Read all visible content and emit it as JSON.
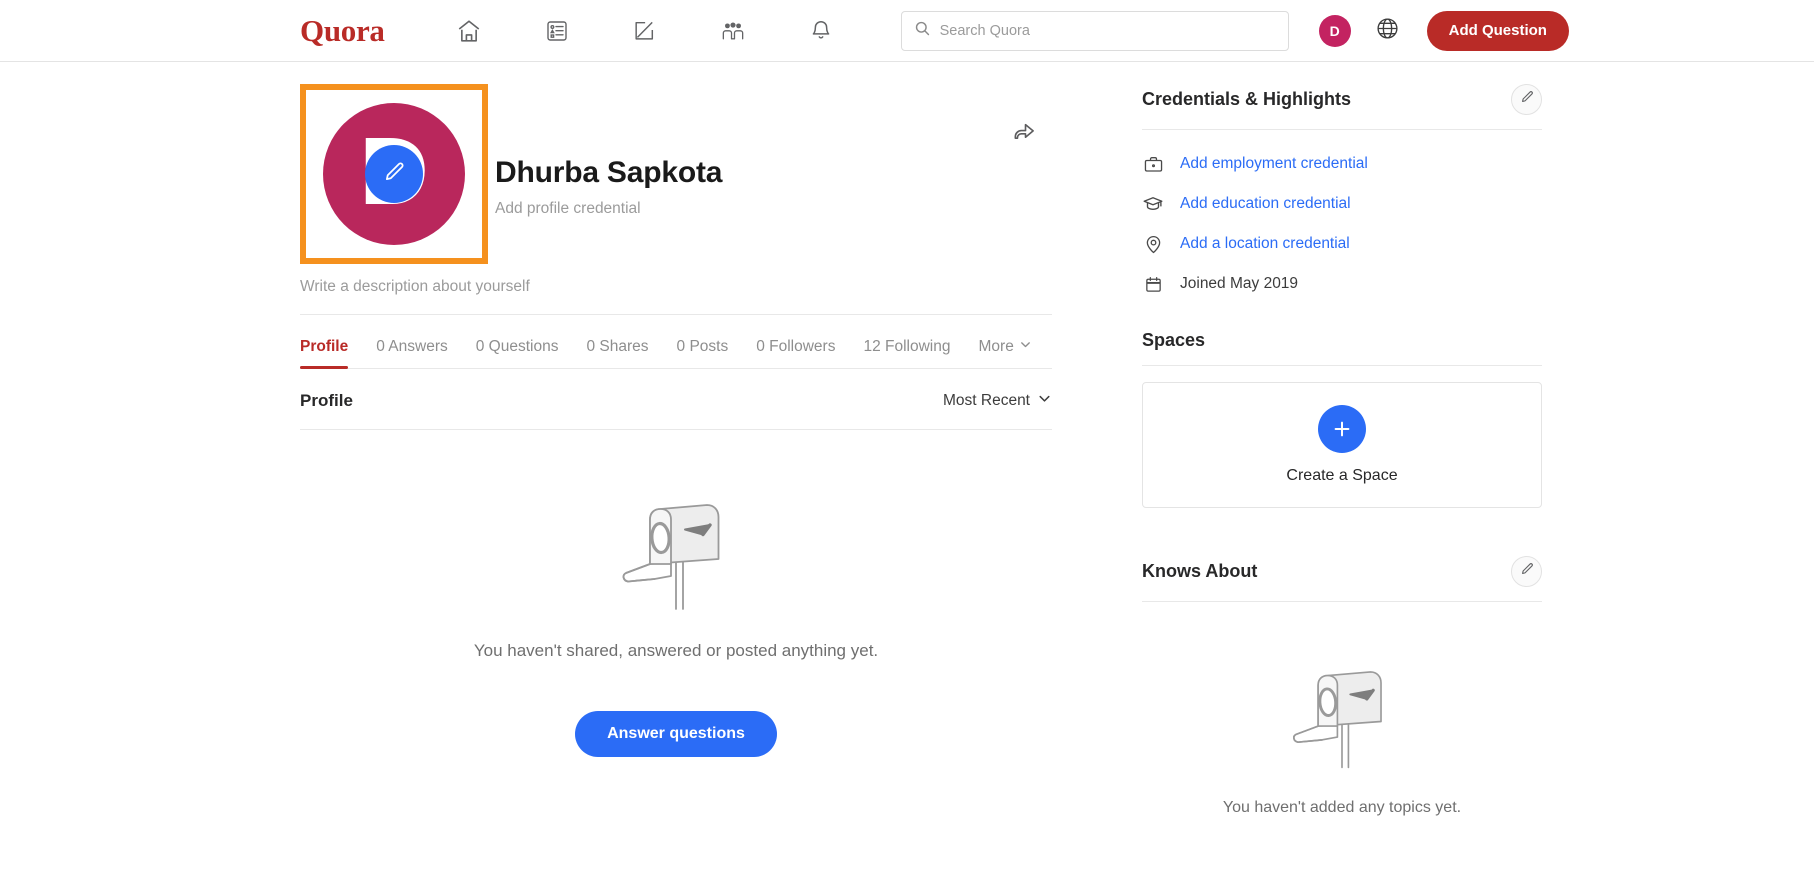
{
  "header": {
    "logo": "Quora",
    "nav": [
      {
        "name": "home-icon",
        "label": "Home"
      },
      {
        "name": "answers-icon",
        "label": "Answers"
      },
      {
        "name": "write-icon",
        "label": "Write"
      },
      {
        "name": "spaces-icon",
        "label": "Spaces"
      },
      {
        "name": "notifications-icon",
        "label": "Notifications"
      }
    ],
    "search": {
      "placeholder": "Search Quora",
      "value": "",
      "icon": "search-icon"
    },
    "user_initial": "D",
    "language_icon": "globe-icon",
    "add_question_label": "Add Question",
    "brand_color": "#b92b27"
  },
  "profile": {
    "avatar_letter": "D",
    "avatar_color": "#b9275c",
    "avatar_edit_color": "#2b6cf6",
    "highlight_color": "#f5911e",
    "name": "Dhurba Sapkota",
    "credential_prompt": "Add profile credential",
    "description_prompt": "Write a description about yourself",
    "share_icon": "share-arrow-icon",
    "tabs": [
      {
        "label": "Profile",
        "active": true
      },
      {
        "label": "0 Answers",
        "active": false
      },
      {
        "label": "0 Questions",
        "active": false
      },
      {
        "label": "0 Shares",
        "active": false
      },
      {
        "label": "0 Posts",
        "active": false
      },
      {
        "label": "0 Followers",
        "active": false
      },
      {
        "label": "12 Following",
        "active": false
      },
      {
        "label": "More",
        "active": false,
        "caret": true
      }
    ]
  },
  "content": {
    "title": "Profile",
    "sort_label": "Most Recent",
    "empty_text": "You haven't shared, answered or posted anything yet.",
    "empty_illustration": "mailbox-illustration",
    "answer_button": "Answer questions"
  },
  "sidebar": {
    "credentials": {
      "title": "Credentials & Highlights",
      "edit_icon": "pencil-icon",
      "items": [
        {
          "icon": "briefcase-icon",
          "label": "Add employment credential",
          "link": true
        },
        {
          "icon": "graduation-cap-icon",
          "label": "Add education credential",
          "link": true
        },
        {
          "icon": "location-pin-icon",
          "label": "Add a location credential",
          "link": true
        },
        {
          "icon": "calendar-icon",
          "label": "Joined May 2019",
          "link": false
        }
      ]
    },
    "spaces": {
      "title": "Spaces",
      "create_label": "Create a Space",
      "plus_icon": "plus-icon"
    },
    "knows_about": {
      "title": "Knows About",
      "edit_icon": "pencil-icon",
      "empty_text": "You haven't added any topics yet.",
      "empty_illustration": "mailbox-illustration"
    }
  }
}
